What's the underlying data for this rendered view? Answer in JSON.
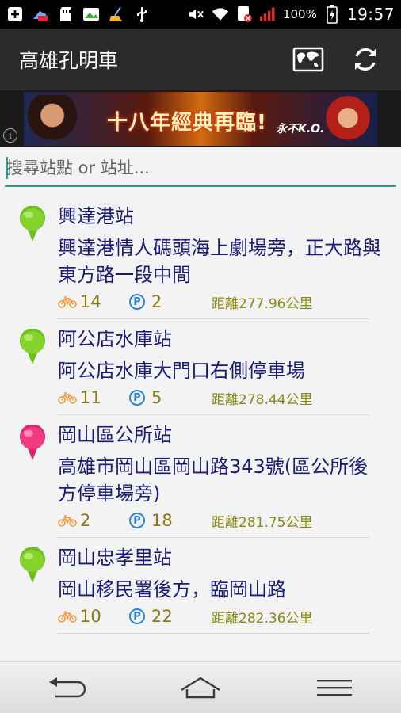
{
  "status_bar": {
    "icons": [
      "add-box-icon",
      "battery-saver-icon",
      "sd-card-icon",
      "image-icon",
      "broom-icon",
      "usb-icon",
      "mute-icon",
      "wifi-icon",
      "data-blocked-icon",
      "signal-icon",
      "battery-charging-icon"
    ],
    "battery": "100%",
    "time": "19:57"
  },
  "action_bar": {
    "title": "高雄孔明車",
    "map_icon": "map-icon",
    "refresh_icon": "refresh-icon"
  },
  "ad": {
    "headline": "十八年經典再臨!",
    "tag": "永不K.O.",
    "info_icon": "info-icon"
  },
  "search": {
    "placeholder": "搜尋站點 or 站址..."
  },
  "stations": [
    {
      "name": "興達港站",
      "address": "興達港情人碼頭海上劇場旁，正大路與東方路一段中間",
      "bikes": "14",
      "parking": "2",
      "distance": "距離277.96公里",
      "pin_color": "#6cbf1e"
    },
    {
      "name": "阿公店水庫站",
      "address": "阿公店水庫大門口右側停車場",
      "bikes": "11",
      "parking": "5",
      "distance": "距離278.44公里",
      "pin_color": "#6cbf1e"
    },
    {
      "name": "岡山區公所站",
      "address": "高雄市岡山區岡山路343號(區公所後方停車場旁)",
      "bikes": "2",
      "parking": "18",
      "distance": "距離281.75公里",
      "pin_color": "#e0246a"
    },
    {
      "name": "岡山忠孝里站",
      "address": "岡山移民署後方，臨岡山路",
      "bikes": "10",
      "parking": "22",
      "distance": "距離282.36公里",
      "pin_color": "#6cbf1e"
    }
  ],
  "colors": {
    "accent": "#2f9a8e",
    "text_primary": "#1a1a7a",
    "count_text": "#8a7a12",
    "bike_icon": "#f29a3a",
    "parking_icon": "#2d84d6"
  },
  "nav_bar": {
    "back_icon": "back-icon",
    "home_icon": "home-icon",
    "menu_icon": "menu-icon"
  }
}
